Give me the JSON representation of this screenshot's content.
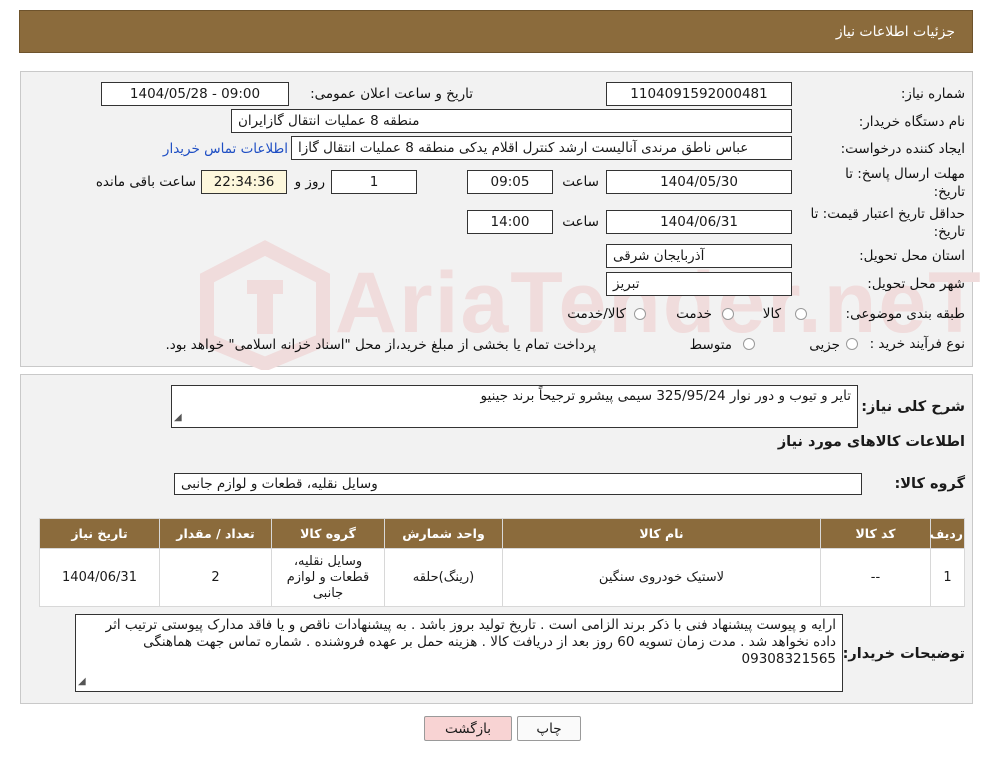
{
  "header": {
    "title": "جزئیات اطلاعات نیاز"
  },
  "watermark": {
    "text": "AriaTender.neT"
  },
  "form": {
    "need_number_label": "شماره نیاز:",
    "need_number": "1104091592000481",
    "announce_label": "تاریخ و ساعت اعلان عمومی:",
    "announce_value": "1404/05/28 - 09:00",
    "buyer_label": "نام دستگاه خریدار:",
    "buyer_value": "منطقه 8 عملیات انتقال گازایران",
    "creator_label": "ایجاد کننده درخواست:",
    "creator_value": "عباس ناطق مرندی آنالیست ارشد کنترل اقلام یدکی منطقه 8 عملیات انتقال گازا",
    "contact_link": "اطلاعات تماس خریدار",
    "deadline_label_1": "مهلت ارسال پاسخ: تا",
    "deadline_label_2": "تاریخ:",
    "deadline_date": "1404/05/30",
    "time_label": "ساعت",
    "deadline_time": "09:05",
    "days_value": "1",
    "days_label": "روز و",
    "remaining_time": "22:34:36",
    "remaining_label": "ساعت باقی مانده",
    "validity_label_1": "حداقل تاریخ اعتبار قیمت: تا",
    "validity_label_2": "تاریخ:",
    "validity_date": "1404/06/31",
    "validity_time_label": "ساعت",
    "validity_time": "14:00",
    "province_label": "استان محل تحویل:",
    "province_value": "آذربایجان شرقی",
    "city_label": "شهر محل تحویل:",
    "city_value": "تبریز",
    "category_label": "طبقه بندی موضوعی:",
    "category_options": [
      "کالا",
      "خدمت",
      "کالا/خدمت"
    ],
    "process_label": "نوع فرآیند خرید :",
    "process_options": [
      "جزیی",
      "متوسط"
    ],
    "process_note": "پرداخت تمام یا بخشی از مبلغ خرید،از محل \"اسناد خزانه اسلامی\" خواهد بود."
  },
  "details": {
    "summary_label": "شرح کلی نیاز:",
    "summary_value": "تایر و تیوب و دور نوار 325/95/24 سیمی پیشرو ترجیحاً برند جینیو",
    "goods_info_title": "اطلاعات کالاهای مورد نیاز",
    "goods_group_label": "گروه کالا:",
    "goods_group_value": "وسایل نقلیه، قطعات و لوازم جانبی",
    "table": {
      "headers": [
        "ردیف",
        "کد کالا",
        "نام کالا",
        "واحد شمارش",
        "گروه کالا",
        "تعداد / مقدار",
        "تاریخ نیاز"
      ],
      "rows": [
        [
          "1",
          "--",
          "لاستیک خودروی سنگین",
          "(رینگ)حلقه",
          "وسایل نقلیه، قطعات و لوازم جانبی",
          "2",
          "1404/06/31"
        ]
      ]
    },
    "buyer_notes_label": "توضیحات خریدار:",
    "buyer_notes_value": "ارایه و پیوست پیشنهاد فنی با ذکر برند الزامی است . تاریخ تولید بروز باشد . به پیشنهادات ناقص و یا فاقد مدارک پیوستی ترتیب اثر داده نخواهد شد . مدت زمان تسویه 60 روز بعد از دریافت کالا . هزینه حمل بر عهده فروشنده . شماره تماس جهت هماهنگی 09308321565"
  },
  "buttons": {
    "print": "چاپ",
    "back": "بازگشت"
  },
  "colors": {
    "header_bg": "#8b6b3c",
    "link": "#1f4fc4",
    "back_button_bg": "#f8d3d3"
  }
}
